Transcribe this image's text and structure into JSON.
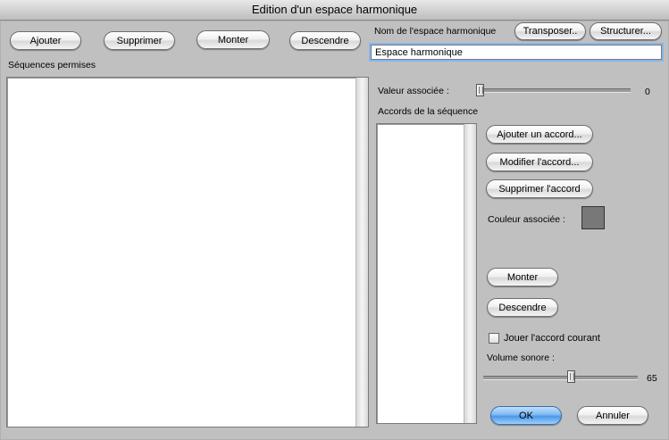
{
  "window": {
    "title": "Edition d'un espace harmonique"
  },
  "top_buttons": {
    "add": "Ajouter",
    "delete": "Supprimer",
    "up": "Monter",
    "down": "Descendre"
  },
  "sequences": {
    "label": "Séquences permises",
    "items": []
  },
  "name_field": {
    "label": "Nom de l'espace harmonique",
    "value": "Espace harmonique"
  },
  "actions": {
    "transpose": "Transposer..",
    "structure": "Structurer..."
  },
  "associated_value": {
    "label": "Valeur associée :",
    "value": "0"
  },
  "chords": {
    "label": "Accords de la séquence",
    "items": [],
    "add": "Ajouter un accord...",
    "modify": "Modifier l'accord...",
    "delete": "Supprimer l'accord",
    "color_label": "Couleur associée :",
    "color": "#787878",
    "up": "Monter",
    "down": "Descendre"
  },
  "play_current": {
    "label": "Jouer l'accord courant",
    "checked": false
  },
  "volume": {
    "label": "Volume sonore :",
    "value": "65"
  },
  "footer": {
    "ok": "OK",
    "cancel": "Annuler"
  }
}
